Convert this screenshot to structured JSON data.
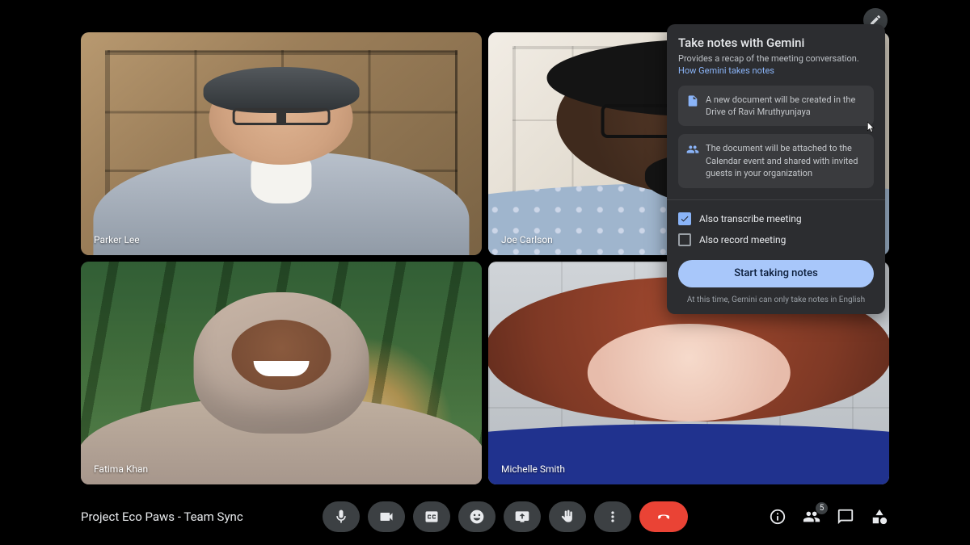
{
  "meeting_title": "Project Eco Paws - Team Sync",
  "participants": [
    {
      "name": "Parker Lee"
    },
    {
      "name": "Joe Carlson"
    },
    {
      "name": "Fatima Khan"
    },
    {
      "name": "Michelle Smith"
    }
  ],
  "people_badge_count": "5",
  "gemini_panel": {
    "title": "Take notes with Gemini",
    "subtitle": "Provides a recap of the meeting conversation.",
    "link_text": "How Gemini takes notes",
    "card_doc": "A new document will be created in the Drive of Ravi Mruthyunjaya",
    "card_calendar": "The document will be attached to the Calendar event and shared with invited guests in your organization",
    "transcribe_label": "Also transcribe meeting",
    "record_label": "Also record meeting",
    "start_button": "Start taking notes",
    "disclaimer": "At this time, Gemini can only take notes in English"
  },
  "colors": {
    "accent": "#8ab4f8",
    "primary_button": "#a8c7fa",
    "end_call": "#ea4335",
    "surface": "#2c2d30"
  }
}
